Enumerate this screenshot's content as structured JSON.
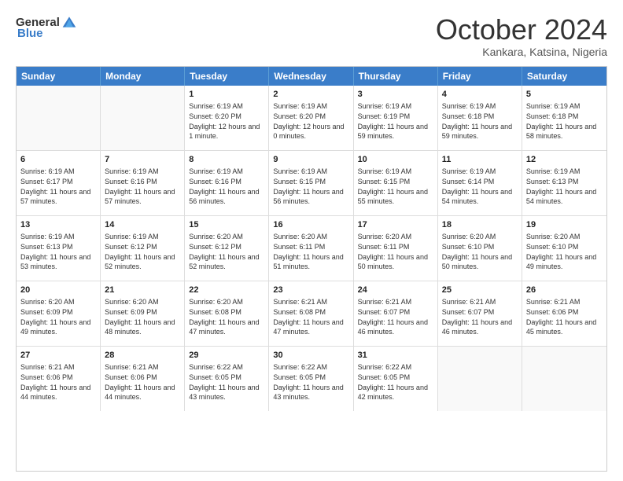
{
  "header": {
    "logo_general": "General",
    "logo_blue": "Blue",
    "month_title": "October 2024",
    "location": "Kankara, Katsina, Nigeria"
  },
  "weekdays": [
    "Sunday",
    "Monday",
    "Tuesday",
    "Wednesday",
    "Thursday",
    "Friday",
    "Saturday"
  ],
  "weeks": [
    [
      {
        "day": "",
        "sunrise": "",
        "sunset": "",
        "daylight": ""
      },
      {
        "day": "",
        "sunrise": "",
        "sunset": "",
        "daylight": ""
      },
      {
        "day": "1",
        "sunrise": "Sunrise: 6:19 AM",
        "sunset": "Sunset: 6:20 PM",
        "daylight": "Daylight: 12 hours and 1 minute."
      },
      {
        "day": "2",
        "sunrise": "Sunrise: 6:19 AM",
        "sunset": "Sunset: 6:20 PM",
        "daylight": "Daylight: 12 hours and 0 minutes."
      },
      {
        "day": "3",
        "sunrise": "Sunrise: 6:19 AM",
        "sunset": "Sunset: 6:19 PM",
        "daylight": "Daylight: 11 hours and 59 minutes."
      },
      {
        "day": "4",
        "sunrise": "Sunrise: 6:19 AM",
        "sunset": "Sunset: 6:18 PM",
        "daylight": "Daylight: 11 hours and 59 minutes."
      },
      {
        "day": "5",
        "sunrise": "Sunrise: 6:19 AM",
        "sunset": "Sunset: 6:18 PM",
        "daylight": "Daylight: 11 hours and 58 minutes."
      }
    ],
    [
      {
        "day": "6",
        "sunrise": "Sunrise: 6:19 AM",
        "sunset": "Sunset: 6:17 PM",
        "daylight": "Daylight: 11 hours and 57 minutes."
      },
      {
        "day": "7",
        "sunrise": "Sunrise: 6:19 AM",
        "sunset": "Sunset: 6:16 PM",
        "daylight": "Daylight: 11 hours and 57 minutes."
      },
      {
        "day": "8",
        "sunrise": "Sunrise: 6:19 AM",
        "sunset": "Sunset: 6:16 PM",
        "daylight": "Daylight: 11 hours and 56 minutes."
      },
      {
        "day": "9",
        "sunrise": "Sunrise: 6:19 AM",
        "sunset": "Sunset: 6:15 PM",
        "daylight": "Daylight: 11 hours and 56 minutes."
      },
      {
        "day": "10",
        "sunrise": "Sunrise: 6:19 AM",
        "sunset": "Sunset: 6:15 PM",
        "daylight": "Daylight: 11 hours and 55 minutes."
      },
      {
        "day": "11",
        "sunrise": "Sunrise: 6:19 AM",
        "sunset": "Sunset: 6:14 PM",
        "daylight": "Daylight: 11 hours and 54 minutes."
      },
      {
        "day": "12",
        "sunrise": "Sunrise: 6:19 AM",
        "sunset": "Sunset: 6:13 PM",
        "daylight": "Daylight: 11 hours and 54 minutes."
      }
    ],
    [
      {
        "day": "13",
        "sunrise": "Sunrise: 6:19 AM",
        "sunset": "Sunset: 6:13 PM",
        "daylight": "Daylight: 11 hours and 53 minutes."
      },
      {
        "day": "14",
        "sunrise": "Sunrise: 6:19 AM",
        "sunset": "Sunset: 6:12 PM",
        "daylight": "Daylight: 11 hours and 52 minutes."
      },
      {
        "day": "15",
        "sunrise": "Sunrise: 6:20 AM",
        "sunset": "Sunset: 6:12 PM",
        "daylight": "Daylight: 11 hours and 52 minutes."
      },
      {
        "day": "16",
        "sunrise": "Sunrise: 6:20 AM",
        "sunset": "Sunset: 6:11 PM",
        "daylight": "Daylight: 11 hours and 51 minutes."
      },
      {
        "day": "17",
        "sunrise": "Sunrise: 6:20 AM",
        "sunset": "Sunset: 6:11 PM",
        "daylight": "Daylight: 11 hours and 50 minutes."
      },
      {
        "day": "18",
        "sunrise": "Sunrise: 6:20 AM",
        "sunset": "Sunset: 6:10 PM",
        "daylight": "Daylight: 11 hours and 50 minutes."
      },
      {
        "day": "19",
        "sunrise": "Sunrise: 6:20 AM",
        "sunset": "Sunset: 6:10 PM",
        "daylight": "Daylight: 11 hours and 49 minutes."
      }
    ],
    [
      {
        "day": "20",
        "sunrise": "Sunrise: 6:20 AM",
        "sunset": "Sunset: 6:09 PM",
        "daylight": "Daylight: 11 hours and 49 minutes."
      },
      {
        "day": "21",
        "sunrise": "Sunrise: 6:20 AM",
        "sunset": "Sunset: 6:09 PM",
        "daylight": "Daylight: 11 hours and 48 minutes."
      },
      {
        "day": "22",
        "sunrise": "Sunrise: 6:20 AM",
        "sunset": "Sunset: 6:08 PM",
        "daylight": "Daylight: 11 hours and 47 minutes."
      },
      {
        "day": "23",
        "sunrise": "Sunrise: 6:21 AM",
        "sunset": "Sunset: 6:08 PM",
        "daylight": "Daylight: 11 hours and 47 minutes."
      },
      {
        "day": "24",
        "sunrise": "Sunrise: 6:21 AM",
        "sunset": "Sunset: 6:07 PM",
        "daylight": "Daylight: 11 hours and 46 minutes."
      },
      {
        "day": "25",
        "sunrise": "Sunrise: 6:21 AM",
        "sunset": "Sunset: 6:07 PM",
        "daylight": "Daylight: 11 hours and 46 minutes."
      },
      {
        "day": "26",
        "sunrise": "Sunrise: 6:21 AM",
        "sunset": "Sunset: 6:06 PM",
        "daylight": "Daylight: 11 hours and 45 minutes."
      }
    ],
    [
      {
        "day": "27",
        "sunrise": "Sunrise: 6:21 AM",
        "sunset": "Sunset: 6:06 PM",
        "daylight": "Daylight: 11 hours and 44 minutes."
      },
      {
        "day": "28",
        "sunrise": "Sunrise: 6:21 AM",
        "sunset": "Sunset: 6:06 PM",
        "daylight": "Daylight: 11 hours and 44 minutes."
      },
      {
        "day": "29",
        "sunrise": "Sunrise: 6:22 AM",
        "sunset": "Sunset: 6:05 PM",
        "daylight": "Daylight: 11 hours and 43 minutes."
      },
      {
        "day": "30",
        "sunrise": "Sunrise: 6:22 AM",
        "sunset": "Sunset: 6:05 PM",
        "daylight": "Daylight: 11 hours and 43 minutes."
      },
      {
        "day": "31",
        "sunrise": "Sunrise: 6:22 AM",
        "sunset": "Sunset: 6:05 PM",
        "daylight": "Daylight: 11 hours and 42 minutes."
      },
      {
        "day": "",
        "sunrise": "",
        "sunset": "",
        "daylight": ""
      },
      {
        "day": "",
        "sunrise": "",
        "sunset": "",
        "daylight": ""
      }
    ]
  ]
}
